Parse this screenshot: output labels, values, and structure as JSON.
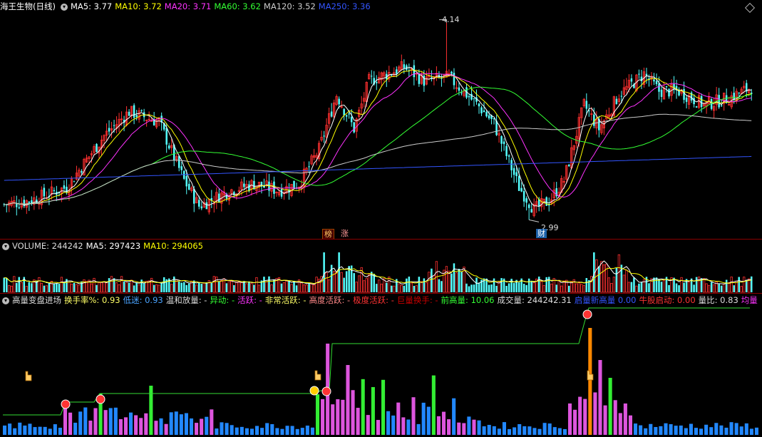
{
  "price_header": {
    "title": "海王生物(日线)",
    "ma": [
      {
        "label": "MA5: 3.77",
        "color": "#ffffff"
      },
      {
        "label": "MA10: 3.72",
        "color": "#ffff00"
      },
      {
        "label": "MA20: 3.71",
        "color": "#ff33ff"
      },
      {
        "label": "MA60: 3.62",
        "color": "#33ff33"
      },
      {
        "label": "MA120: 3.52",
        "color": "#cccccc"
      },
      {
        "label": "MA250: 3.36",
        "color": "#3355ff"
      }
    ]
  },
  "price_annotations": {
    "high": "4.14",
    "low": "2.99",
    "tag_bang": "榜",
    "tag_zhang": "涨",
    "tag_cai": "财"
  },
  "volume_header": {
    "title": "VOLUME: 244242",
    "ma5": "MA5: 297423",
    "ma10": "MA10: 294065"
  },
  "indicator_header": {
    "title": "高量变盘进场",
    "items": [
      {
        "label": "换手率%: ",
        "value": "0.93",
        "lc": "#ffff66",
        "vc": "#ffff66"
      },
      {
        "label": "低迷: ",
        "value": "0.93",
        "lc": "#4aa3ff",
        "vc": "#4aa3ff"
      },
      {
        "label": "温和放量: ",
        "value": "-",
        "lc": "#dddddd",
        "vc": "#dddddd"
      },
      {
        "label": "异动: ",
        "value": "-",
        "lc": "#33ff33",
        "vc": "#33ff33"
      },
      {
        "label": "活跃: ",
        "value": "-",
        "lc": "#ff33ff",
        "vc": "#ff33ff"
      },
      {
        "label": "非常活跃: ",
        "value": "-",
        "lc": "#ffff66",
        "vc": "#ffff66"
      },
      {
        "label": "高度活跃: ",
        "value": "-",
        "lc": "#ff8888",
        "vc": "#ff8888"
      },
      {
        "label": "极度活跃: ",
        "value": "-",
        "lc": "#ff3333",
        "vc": "#ff3333"
      },
      {
        "label": "巨量换手: ",
        "value": "-",
        "lc": "#cc0000",
        "vc": "#cc0000"
      },
      {
        "label": "前高量: ",
        "value": "10.06",
        "lc": "#33ff33",
        "vc": "#33ff33"
      },
      {
        "label": "成交量: ",
        "value": "244242.31",
        "lc": "#dddddd",
        "vc": "#dddddd"
      },
      {
        "label": "启量新高量 ",
        "value": "0.00",
        "lc": "#3355ff",
        "vc": "#3355ff"
      },
      {
        "label": "牛股启动: ",
        "value": "0.00",
        "lc": "#ff3333",
        "vc": "#ff3333"
      },
      {
        "label": "量比: ",
        "value": "0.83",
        "lc": "#dddddd",
        "vc": "#dddddd"
      },
      {
        "label": "均量",
        "value": "",
        "lc": "#ff33ff",
        "vc": "#ff33ff"
      }
    ]
  },
  "colors": {
    "up": "#ff3030",
    "down": "#54ffff",
    "grid": "#8a0000",
    "bg": "#000000"
  },
  "icons": [
    "collapse-circle-icon",
    "diamond-icon",
    "hand-cursor-icon",
    "sell-signal-icon",
    "buy-signal-icon"
  ]
}
